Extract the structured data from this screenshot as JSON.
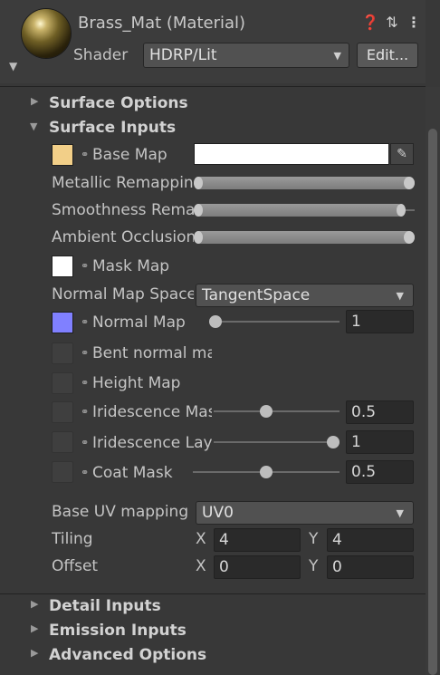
{
  "header": {
    "title": "Brass_Mat (Material)",
    "shader_label": "Shader",
    "shader_value": "HDRP/Lit",
    "edit_label": "Edit...",
    "icons": [
      "help-icon",
      "preset-icon",
      "more-icon"
    ]
  },
  "foldouts": {
    "surface_options": "Surface Options",
    "surface_inputs": "Surface Inputs",
    "detail_inputs": "Detail Inputs",
    "emission_inputs": "Emission Inputs",
    "advanced_options": "Advanced Options"
  },
  "surface_inputs": {
    "base_map": {
      "label": "Base Map",
      "swatch_color": "#f2cf88",
      "color_field": "#ffffff"
    },
    "metallic_remapping": {
      "label": "Metallic Remapping"
    },
    "smoothness_remapping": {
      "label": "Smoothness Remapping"
    },
    "ambient_occlusion": {
      "label": "Ambient Occlusion Remapping"
    },
    "mask_map": {
      "label": "Mask Map",
      "swatch_color": "#ffffff"
    },
    "normal_map_space": {
      "label": "Normal Map Space",
      "value": "TangentSpace"
    },
    "normal_map": {
      "label": "Normal Map",
      "swatch_color": "#8080ff",
      "value": "1",
      "slider_fraction": 0.0
    },
    "bent_normal_map": {
      "label": "Bent normal map"
    },
    "height_map": {
      "label": "Height Map"
    },
    "iridescence_mask": {
      "label": "Iridescence Mask",
      "value": "0.5",
      "slider_fraction": 0.5
    },
    "iridescence_layer": {
      "label": "Iridescence Layer Thickness",
      "value": "1",
      "slider_fraction": 1.0
    },
    "coat_mask": {
      "label": "Coat Mask",
      "value": "0.5",
      "slider_fraction": 0.5
    },
    "base_uv_mapping": {
      "label": "Base UV mapping",
      "value": "UV0"
    },
    "tiling": {
      "label": "Tiling",
      "x_label": "X",
      "x": "4",
      "y_label": "Y",
      "y": "4"
    },
    "offset": {
      "label": "Offset",
      "x_label": "X",
      "x": "0",
      "y_label": "Y",
      "y": "0"
    }
  },
  "colors": {
    "accent_knob": "#bdbdbd",
    "panel_bg": "#383838"
  }
}
